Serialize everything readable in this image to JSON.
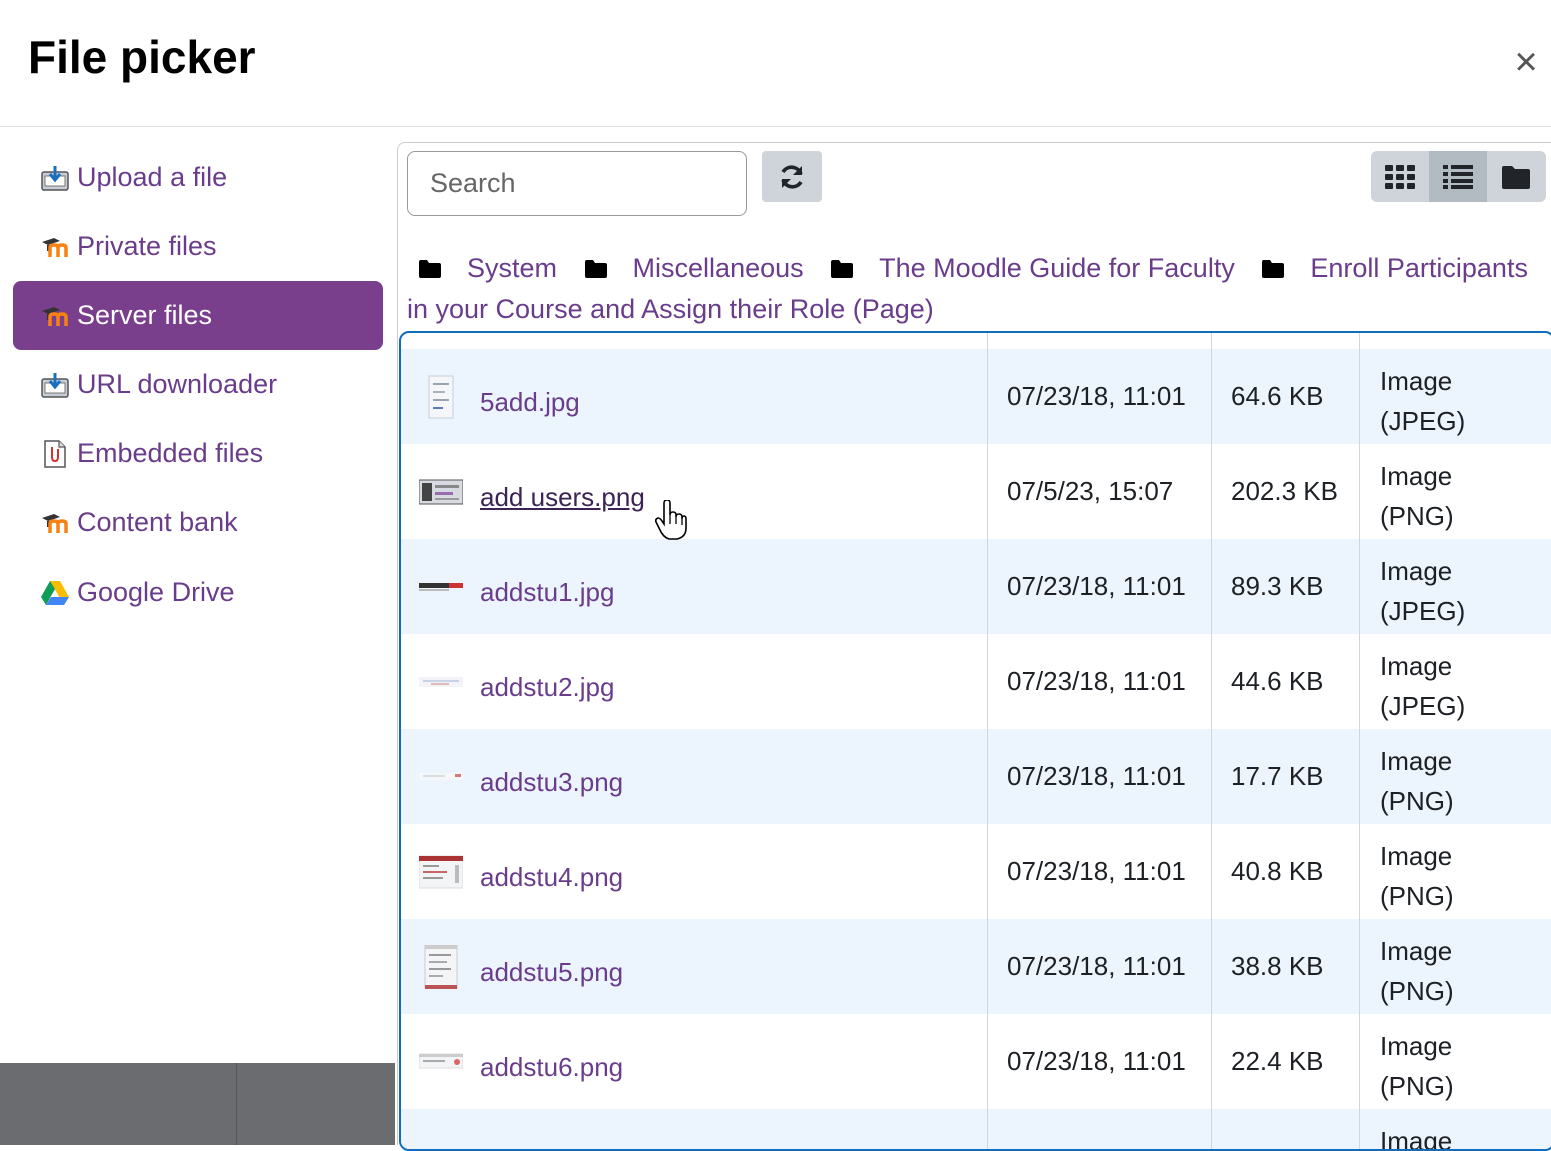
{
  "dialog": {
    "title": "File picker",
    "close_glyph": "×"
  },
  "sidebar": {
    "items": [
      {
        "label": "Upload a file",
        "icon": "upload-icon",
        "active": false
      },
      {
        "label": "Private files",
        "icon": "moodle-icon",
        "active": false
      },
      {
        "label": "Server files",
        "icon": "moodle-icon",
        "active": true
      },
      {
        "label": "URL downloader",
        "icon": "url-download-icon",
        "active": false
      },
      {
        "label": "Embedded files",
        "icon": "embedded-file-icon",
        "active": false
      },
      {
        "label": "Content bank",
        "icon": "moodle-icon",
        "active": false
      },
      {
        "label": "Google Drive",
        "icon": "google-drive-icon",
        "active": false
      }
    ]
  },
  "toolbar": {
    "search_placeholder": "Search",
    "refresh_icon": "refresh-icon",
    "views": [
      {
        "icon": "grid-view-icon",
        "active": false
      },
      {
        "icon": "list-view-icon",
        "active": true
      },
      {
        "icon": "folder-view-icon",
        "active": false
      }
    ]
  },
  "breadcrumb": [
    "System",
    "Miscellaneous",
    "The Moodle Guide for Faculty",
    "Enroll Participants in your Course and Assign their Role (Page)"
  ],
  "files": [
    {
      "name": "5add.jpg",
      "date": "07/23/18, 11:01",
      "size": "64.6 KB",
      "type_line1": "Image",
      "type_line2": "(JPEG)",
      "hover": false
    },
    {
      "name": "add users.png",
      "date": "07/5/23, 15:07",
      "size": "202.3 KB",
      "type_line1": "Image",
      "type_line2": "(PNG)",
      "hover": true
    },
    {
      "name": "addstu1.jpg",
      "date": "07/23/18, 11:01",
      "size": "89.3 KB",
      "type_line1": "Image",
      "type_line2": "(JPEG)",
      "hover": false
    },
    {
      "name": "addstu2.jpg",
      "date": "07/23/18, 11:01",
      "size": "44.6 KB",
      "type_line1": "Image",
      "type_line2": "(JPEG)",
      "hover": false
    },
    {
      "name": "addstu3.png",
      "date": "07/23/18, 11:01",
      "size": "17.7 KB",
      "type_line1": "Image",
      "type_line2": "(PNG)",
      "hover": false
    },
    {
      "name": "addstu4.png",
      "date": "07/23/18, 11:01",
      "size": "40.8 KB",
      "type_line1": "Image",
      "type_line2": "(PNG)",
      "hover": false
    },
    {
      "name": "addstu5.png",
      "date": "07/23/18, 11:01",
      "size": "38.8 KB",
      "type_line1": "Image",
      "type_line2": "(PNG)",
      "hover": false
    },
    {
      "name": "addstu6.png",
      "date": "07/23/18, 11:01",
      "size": "22.4 KB",
      "type_line1": "Image",
      "type_line2": "(PNG)",
      "hover": false
    }
  ],
  "partial_row_type": "Image",
  "colors": {
    "accent": "#7a3f8c",
    "link": "#6a3d8c",
    "focus_border": "#0f6cbf",
    "row_alt": "#ecf4fd"
  }
}
